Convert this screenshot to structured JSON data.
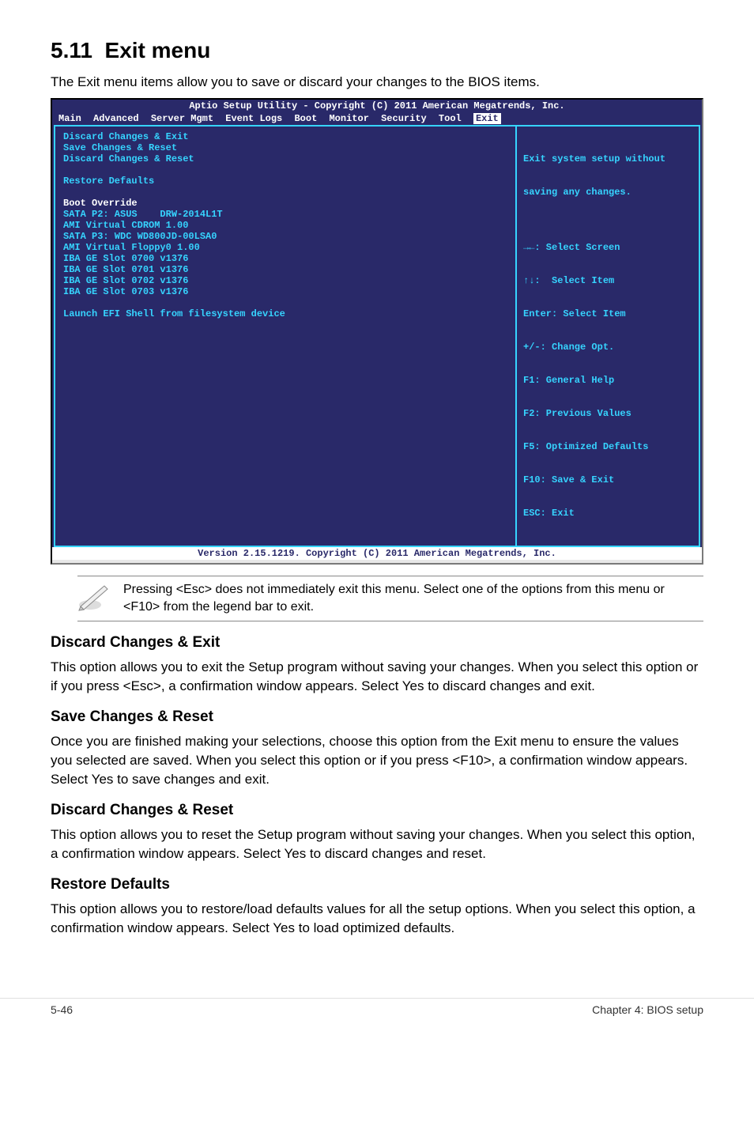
{
  "heading_num": "5.11",
  "heading_txt": "Exit menu",
  "intro": "The Exit menu items allow you to save or discard your changes to the BIOS items.",
  "bios": {
    "title": "Aptio Setup Utility - Copyright (C) 2011 American Megatrends, Inc.",
    "tabs": {
      "list": [
        "Main",
        "Advanced",
        "Server Mgmt",
        "Event Logs",
        "Boot",
        "Monitor",
        "Security",
        "Tool"
      ],
      "active": "Exit"
    },
    "left": {
      "l1": "Discard Changes & Exit",
      "l2": "Save Changes & Reset",
      "l3": "Discard Changes & Reset",
      "l4": "Restore Defaults",
      "l5": "Boot Override",
      "l6": "SATA P2: ASUS    DRW-2014L1T",
      "l7": "AMI Virtual CDROM 1.00",
      "l8": "SATA P3: WDC WD800JD-00LSA0",
      "l9": "AMI Virtual Floppy0 1.00",
      "l10": "IBA GE Slot 0700 v1376",
      "l11": "IBA GE Slot 0701 v1376",
      "l12": "IBA GE Slot 0702 v1376",
      "l13": "IBA GE Slot 0703 v1376",
      "l14": "Launch EFI Shell from filesystem device"
    },
    "right": {
      "help1": "Exit system setup without",
      "help2": "saving any changes.",
      "k1": "→←: Select Screen",
      "k2": "↑↓:  Select Item",
      "k3": "Enter: Select Item",
      "k4": "+/-: Change Opt.",
      "k5": "F1: General Help",
      "k6": "F2: Previous Values",
      "k7": "F5: Optimized Defaults",
      "k8": "F10: Save & Exit",
      "k9": "ESC: Exit"
    },
    "footer": "Version 2.15.1219. Copyright (C) 2011 American Megatrends, Inc."
  },
  "note": "Pressing <Esc> does not immediately exit this menu. Select one of the options from this menu or <F10> from the legend bar to exit.",
  "sections": {
    "s1h": "Discard Changes & Exit",
    "s1p": "This option allows you to exit the Setup program without saving your changes. When you select this option or if you press <Esc>, a confirmation window appears. Select Yes to discard changes and exit.",
    "s2h": "Save Changes & Reset",
    "s2p": "Once you are finished making your selections, choose this option from the Exit menu to ensure the values you selected are saved. When you select this option or if you press <F10>, a confirmation window appears. Select Yes to save changes and exit.",
    "s3h": "Discard Changes & Reset",
    "s3p": "This option allows you to reset the Setup program without saving your changes. When you select this option, a confirmation window appears. Select Yes to discard changes and reset.",
    "s4h": "Restore Defaults",
    "s4p": "This option allows you to restore/load defaults values for all the setup options. When you select this option, a confirmation window appears. Select Yes to load optimized defaults."
  },
  "footer": {
    "left": "5-46",
    "right": "Chapter 4: BIOS setup"
  }
}
